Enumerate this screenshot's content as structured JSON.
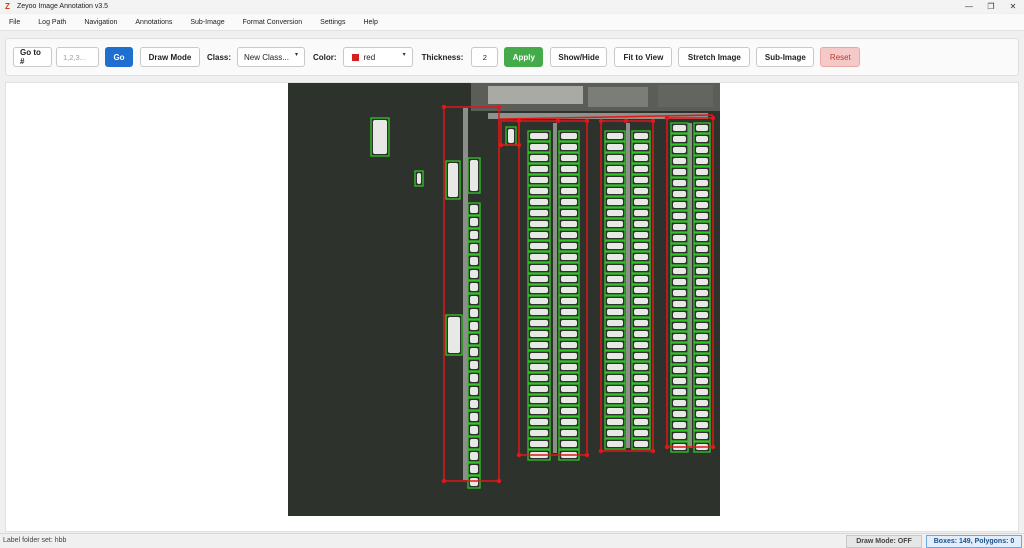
{
  "window": {
    "app_icon": "Z",
    "title": "Zeyoo Image Annotation v3.5",
    "minimize_glyph": "—",
    "maximize_glyph": "❐",
    "close_glyph": "✕"
  },
  "menu": [
    "File",
    "Log Path",
    "Navigation",
    "Annotations",
    "Sub-Image",
    "Format Conversion",
    "Settings",
    "Help"
  ],
  "toolbar": {
    "goto_label": "Go to #",
    "goto_placeholder": "1,2,3...",
    "go_button": "Go",
    "draw_mode_button": "Draw Mode",
    "class_label": "Class:",
    "class_value": "New Class...",
    "color_label": "Color:",
    "color_value": "red",
    "color_swatch": "#d42020",
    "thickness_label": "Thickness:",
    "thickness_value": "2",
    "apply_button": "Apply",
    "show_hide_button": "Show/Hide",
    "fit_button": "Fit to View",
    "stretch_button": "Stretch Image",
    "subimage_button": "Sub-Image",
    "reset_button": "Reset",
    "dropdown_caret": "▾"
  },
  "colors": {
    "go_blue": "#1e6fcf",
    "apply_green": "#45ab4a",
    "reset_pink": "#f6c9c9",
    "water": "#2d322c",
    "annotation_red": "#e01818",
    "annotation_green": "#34c429"
  },
  "status": {
    "left": "Label folder set: hbb",
    "draw_mode": "Draw Mode: OFF",
    "counts": "Boxes: 149, Polygons: 0"
  }
}
